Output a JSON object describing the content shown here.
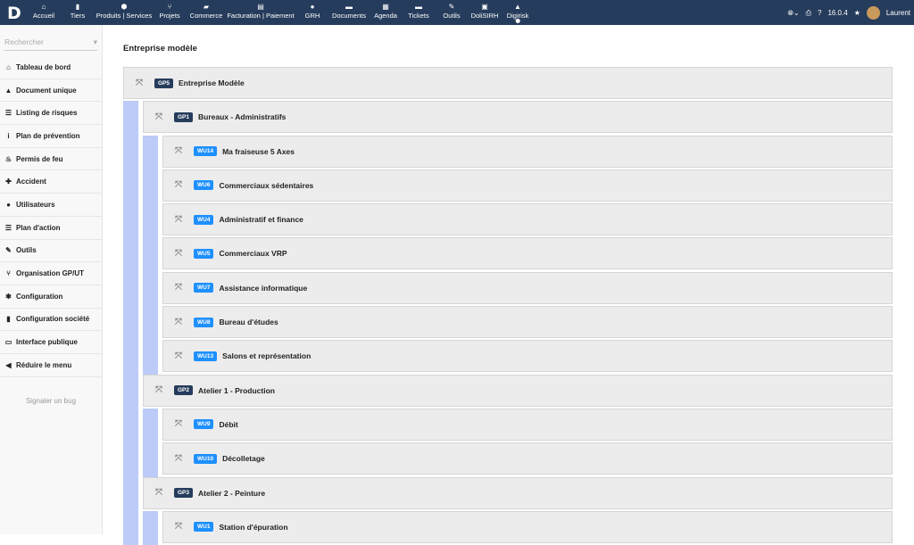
{
  "topbar": {
    "logo": "D",
    "items": [
      {
        "label": "Accueil",
        "icon": "⌂"
      },
      {
        "label": "Tiers",
        "icon": "▮"
      },
      {
        "label": "Produits | Services",
        "icon": "⬢"
      },
      {
        "label": "Projets",
        "icon": "⑂"
      },
      {
        "label": "Commerce",
        "icon": "▰"
      },
      {
        "label": "Facturation | Paiement",
        "icon": "▤"
      },
      {
        "label": "GRH",
        "icon": "●"
      },
      {
        "label": "Documents",
        "icon": "▬"
      },
      {
        "label": "Agenda",
        "icon": "▦"
      },
      {
        "label": "Tickets",
        "icon": "▬"
      },
      {
        "label": "Outils",
        "icon": "✎"
      },
      {
        "label": "DoliSIRH",
        "icon": "▣"
      },
      {
        "label": "Digirisk",
        "icon": "▲"
      }
    ],
    "active": "Digirisk",
    "version": "16.0.4",
    "user": "Laurent"
  },
  "sidebar": {
    "search_placeholder": "Rechercher",
    "items": [
      {
        "label": "Tableau de bord",
        "icon": "⌂"
      },
      {
        "label": "Document unique",
        "icon": "▲"
      },
      {
        "label": "Listing de risques",
        "icon": "☰"
      },
      {
        "label": "Plan de prévention",
        "icon": "i"
      },
      {
        "label": "Permis de feu",
        "icon": "♨"
      },
      {
        "label": "Accident",
        "icon": "✚"
      },
      {
        "label": "Utilisateurs",
        "icon": "●"
      },
      {
        "label": "Plan d'action",
        "icon": "☰"
      },
      {
        "label": "Outils",
        "icon": "✎"
      },
      {
        "label": "Organisation GP/UT",
        "icon": "⑂"
      },
      {
        "label": "Configuration",
        "icon": "✱"
      },
      {
        "label": "Configuration société",
        "icon": "▮"
      },
      {
        "label": "Interface publique",
        "icon": "▭"
      },
      {
        "label": "Réduire le menu",
        "icon": "◀"
      }
    ],
    "bug_link": "Signaler un bug"
  },
  "main": {
    "title": "Entreprise modèle",
    "tree": [
      {
        "level": 0,
        "ref": "GP5",
        "label": "Entreprise Modèle"
      },
      {
        "level": 1,
        "ref": "GP1",
        "label": "Bureaux - Administratifs"
      },
      {
        "level": 2,
        "ref": "WU14",
        "label": "Ma fraiseuse 5 Axes"
      },
      {
        "level": 2,
        "ref": "WU6",
        "label": "Commerciaux sédentaires"
      },
      {
        "level": 2,
        "ref": "WU4",
        "label": "Administratif et finance"
      },
      {
        "level": 2,
        "ref": "WU5",
        "label": "Commerciaux VRP"
      },
      {
        "level": 2,
        "ref": "WU7",
        "label": "Assistance informatique"
      },
      {
        "level": 2,
        "ref": "WU8",
        "label": "Bureau d'études"
      },
      {
        "level": 2,
        "ref": "WU13",
        "label": "Salons et représentation"
      },
      {
        "level": 1,
        "ref": "GP2",
        "label": "Atelier 1 - Production"
      },
      {
        "level": 2,
        "ref": "WU9",
        "label": "Débit"
      },
      {
        "level": 2,
        "ref": "WU10",
        "label": "Décolletage"
      },
      {
        "level": 1,
        "ref": "GP3",
        "label": "Atelier 2 - Peinture"
      },
      {
        "level": 2,
        "ref": "WU1",
        "label": "Station d'épuration"
      }
    ]
  },
  "colors": {
    "gp_badge": "#263c5c",
    "wu_badge": "#1e90ff",
    "strip": "#bccbf7"
  }
}
